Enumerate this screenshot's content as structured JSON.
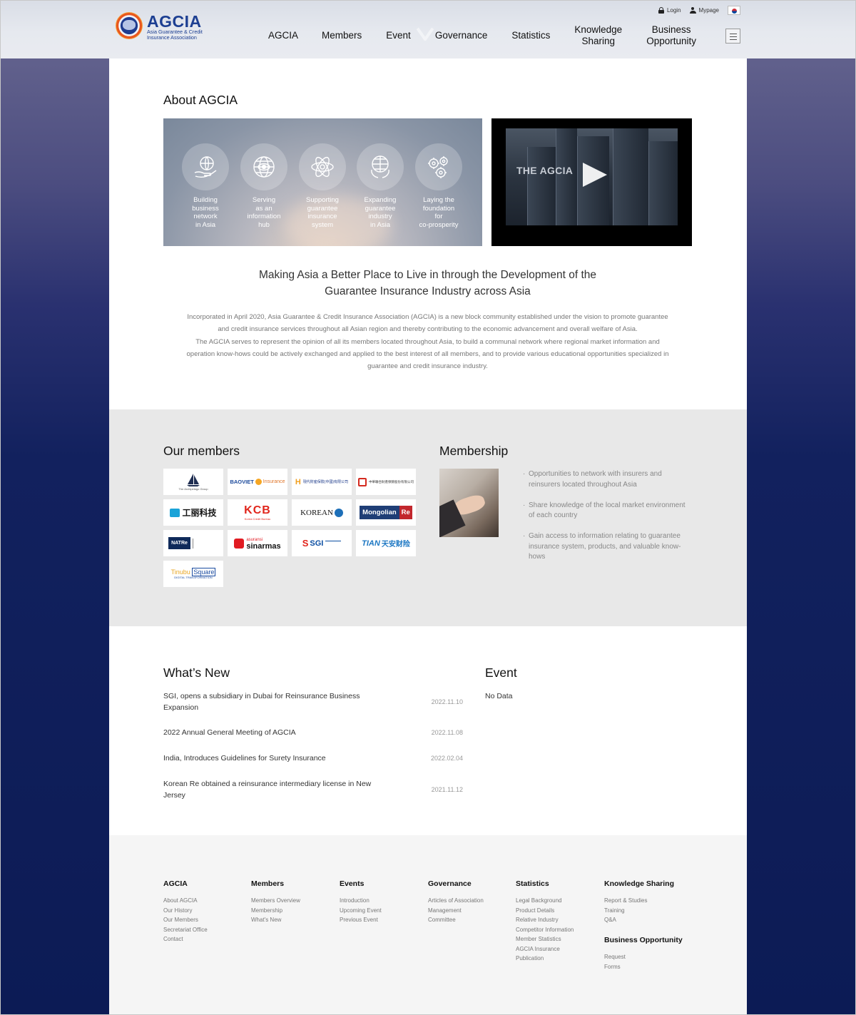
{
  "header": {
    "logo_title": "AGCIA",
    "logo_subtitle_1": "Asia Guarantee & Credit",
    "logo_subtitle_2": "Insurance Association",
    "login": "Login",
    "mypage": "Mypage",
    "nav": [
      "AGCIA",
      "Members",
      "Event",
      "Governance",
      "Statistics",
      "Knowledge\nSharing",
      "Business\nOpportunity"
    ]
  },
  "about": {
    "title": "About AGCIA",
    "pillars": [
      {
        "icon": "hand-globe-icon",
        "label": "Building\nbusiness\nnetwork\nin Asia"
      },
      {
        "icon": "globe-eye-icon",
        "label": "Serving\nas an\ninformation\nhub"
      },
      {
        "icon": "atom-icon",
        "label": "Supporting\nguarantee\ninsurance\nsystem"
      },
      {
        "icon": "brain-globe-icon",
        "label": "Expanding\nguarantee\nindustry\nin Asia"
      },
      {
        "icon": "gears-icon",
        "label": "Laying the\nfoundation\nfor\nco-prosperity"
      }
    ],
    "video_title": "THE AGCIA",
    "tagline_1": "Making Asia a Better Place to Live in through the Development of the",
    "tagline_2": "Guarantee Insurance Industry across Asia",
    "desc": [
      "Incorporated in April 2020, Asia Guarantee & Credit Insurance Association (AGCIA) is a new block community established under the vision to promote guarantee",
      "and credit insurance services throughout all Asian region and thereby contributing to the economic advancement and overall welfare of Asia.",
      "The AGCIA serves to represent the opinion of all its members located throughout Asia, to build a communal network where regional market information and",
      "operation know-hows could be actively exchanged and applied to the best interest of all members, and to provide various educational opportunities specialized in",
      "guarantee and credit insurance industry."
    ]
  },
  "members": {
    "title": "Our members",
    "logos": [
      "The Archipelago Group",
      "BAOVIET Insurance",
      "Hyundai Insurance (China)",
      "China Continent",
      "GONGRAO TECH",
      "KCB",
      "KOREAN Re",
      "Mongolian Re",
      "NAT Re",
      "asuransi sinarmas",
      "SGI",
      "TIAN",
      "Tinubu Square"
    ],
    "logo_text": {
      "archipelago": "The Archipelago Group",
      "baoviet": "BAOVIET",
      "baoviet_ins": "Insurance",
      "hyundai": "現代財産保險(中國)有限公司",
      "china_continent": "中華聯合財產保險股份有限公司",
      "gongrao": "工丽科技",
      "kcb": "KCB",
      "kcb_sub": "Korea Credit Bureau",
      "korean": "KOREAN",
      "mongolian": "Mongolian",
      "re": "Re",
      "natre": "NATRe",
      "sinarmas_top": "asuransi",
      "sinarmas": "sinarmas",
      "sgi": "SGI",
      "tian": "TIAN",
      "tian_cn": "天安财险",
      "tinubu": "Tinubu",
      "square": "Square",
      "tinubu_sub": "DIGITAL TRANSFORMATION"
    }
  },
  "membership": {
    "title": "Membership",
    "benefits": [
      "Opportunities to network with insurers and reinsurers located throughout Asia",
      "Share knowledge of the local market environment of each country",
      "Gain access to information relating to guarantee insurance system, products, and valuable know-hows"
    ]
  },
  "whats_new": {
    "title": "What’s New",
    "items": [
      {
        "title": "SGI, opens a subsidiary in Dubai for Reinsurance Business Expansion",
        "date": "2022.11.10"
      },
      {
        "title": "2022 Annual General Meeting of AGCIA",
        "date": "2022.11.08"
      },
      {
        "title": "India, Introduces Guidelines for Surety Insurance",
        "date": "2022.02.04"
      },
      {
        "title": "Korean Re obtained a reinsurance intermediary license in New Jersey",
        "date": "2021.11.12"
      }
    ]
  },
  "event": {
    "title": "Event",
    "empty": "No Data"
  },
  "footer": {
    "columns": [
      {
        "head": "AGCIA",
        "links": [
          "About AGCIA",
          "Our History",
          "Our Members",
          "Secretariat Office",
          "Contact"
        ]
      },
      {
        "head": "Members",
        "links": [
          "Members Overview",
          "Membership",
          "What's New"
        ]
      },
      {
        "head": "Events",
        "links": [
          "Introduction",
          "Upcoming Event",
          "Previous Event"
        ]
      },
      {
        "head": "Governance",
        "links": [
          "Articles of Association",
          "Management",
          "Committee"
        ]
      },
      {
        "head": "Statistics",
        "links": [
          "Legal Background",
          "Product Details",
          "Relative Industry",
          "Competitor Information",
          "Member Statistics",
          "AGCIA Insurance",
          "Publication"
        ]
      },
      {
        "head": "Knowledge Sharing",
        "links": [
          "Report & Studies",
          "Training",
          "Q&A"
        ]
      }
    ],
    "extra": {
      "head": "Business Opportunity",
      "links": [
        "Request",
        "Forms"
      ]
    }
  },
  "colors": {
    "brand_blue": "#1d3f92",
    "brand_orange": "#e8571f",
    "navy_bg": "#0c1b55"
  }
}
